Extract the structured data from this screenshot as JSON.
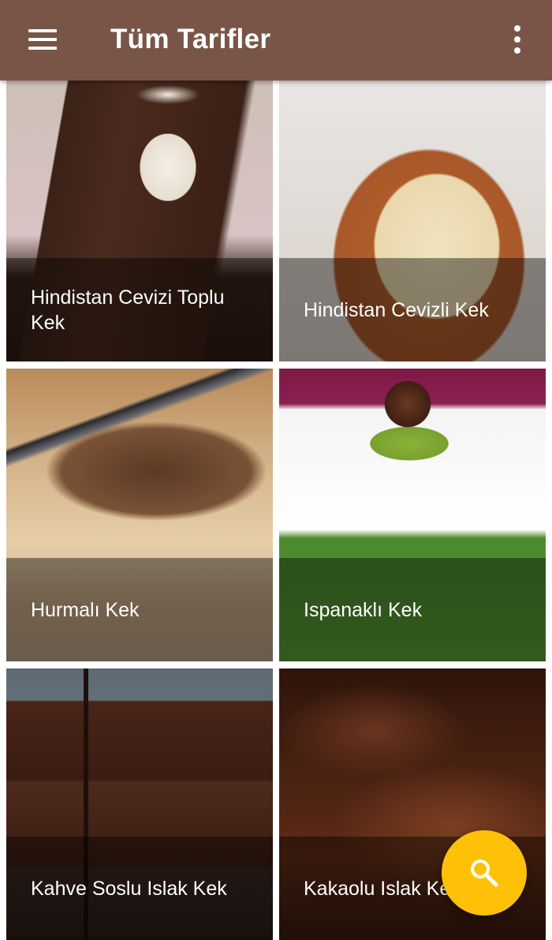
{
  "app_bar": {
    "title": "Tüm Tarifler",
    "menu_icon": "menu-icon",
    "overflow_icon": "more-vert-icon",
    "background_color": "#795548"
  },
  "recipes": [
    {
      "name": "Hindistan Cevizi Toplu Kek"
    },
    {
      "name": "Hindistan Cevizli Kek"
    },
    {
      "name": "Hurmalı Kek"
    },
    {
      "name": "Ispanaklı Kek"
    },
    {
      "name": "Kahve Soslu Islak Kek"
    },
    {
      "name": "Kakaolu Islak Kek"
    }
  ],
  "fab": {
    "icon": "search-icon",
    "color": "#FFC107"
  }
}
